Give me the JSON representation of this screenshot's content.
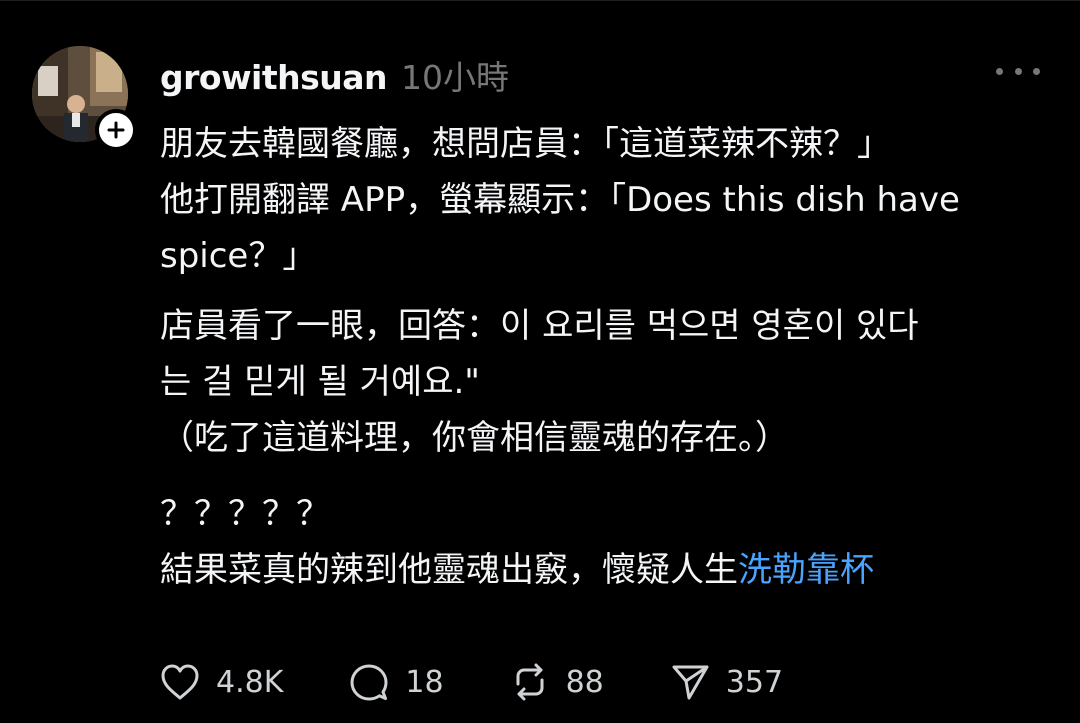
{
  "post": {
    "username": "growithsuan",
    "time": "10小時",
    "lines": {
      "l1": "朋友去韓國餐廳，想問店員：「這道菜辣不辣？」",
      "l2": "他打開翻譯 APP，螢幕顯示：「Does this dish have",
      "l3": "spice？」",
      "l4": "店員看了一眼，回答：이 요리를 먹으면 영혼이 있다",
      "l5": "는 걸 믿게 될 거예요.\"",
      "l6": "（吃了這道料理，你會相信靈魂的存在。）",
      "l7": "？？？？？",
      "l8": "結果菜真的辣到他靈魂出竅，懷疑人生",
      "hashtag": "洗勒靠杯"
    }
  },
  "actions": {
    "likes": "4.8K",
    "comments": "18",
    "reposts": "88",
    "shares": "357"
  },
  "icons": {
    "like": "heart-icon",
    "comment": "comment-bubble-icon",
    "repost": "repost-icon",
    "share": "send-icon",
    "more": "more-horizontal-icon",
    "follow": "plus-icon"
  },
  "colors": {
    "background": "#000000",
    "text": "#f3f5f7",
    "muted": "#777777",
    "hashtag": "#4aa3ff"
  }
}
